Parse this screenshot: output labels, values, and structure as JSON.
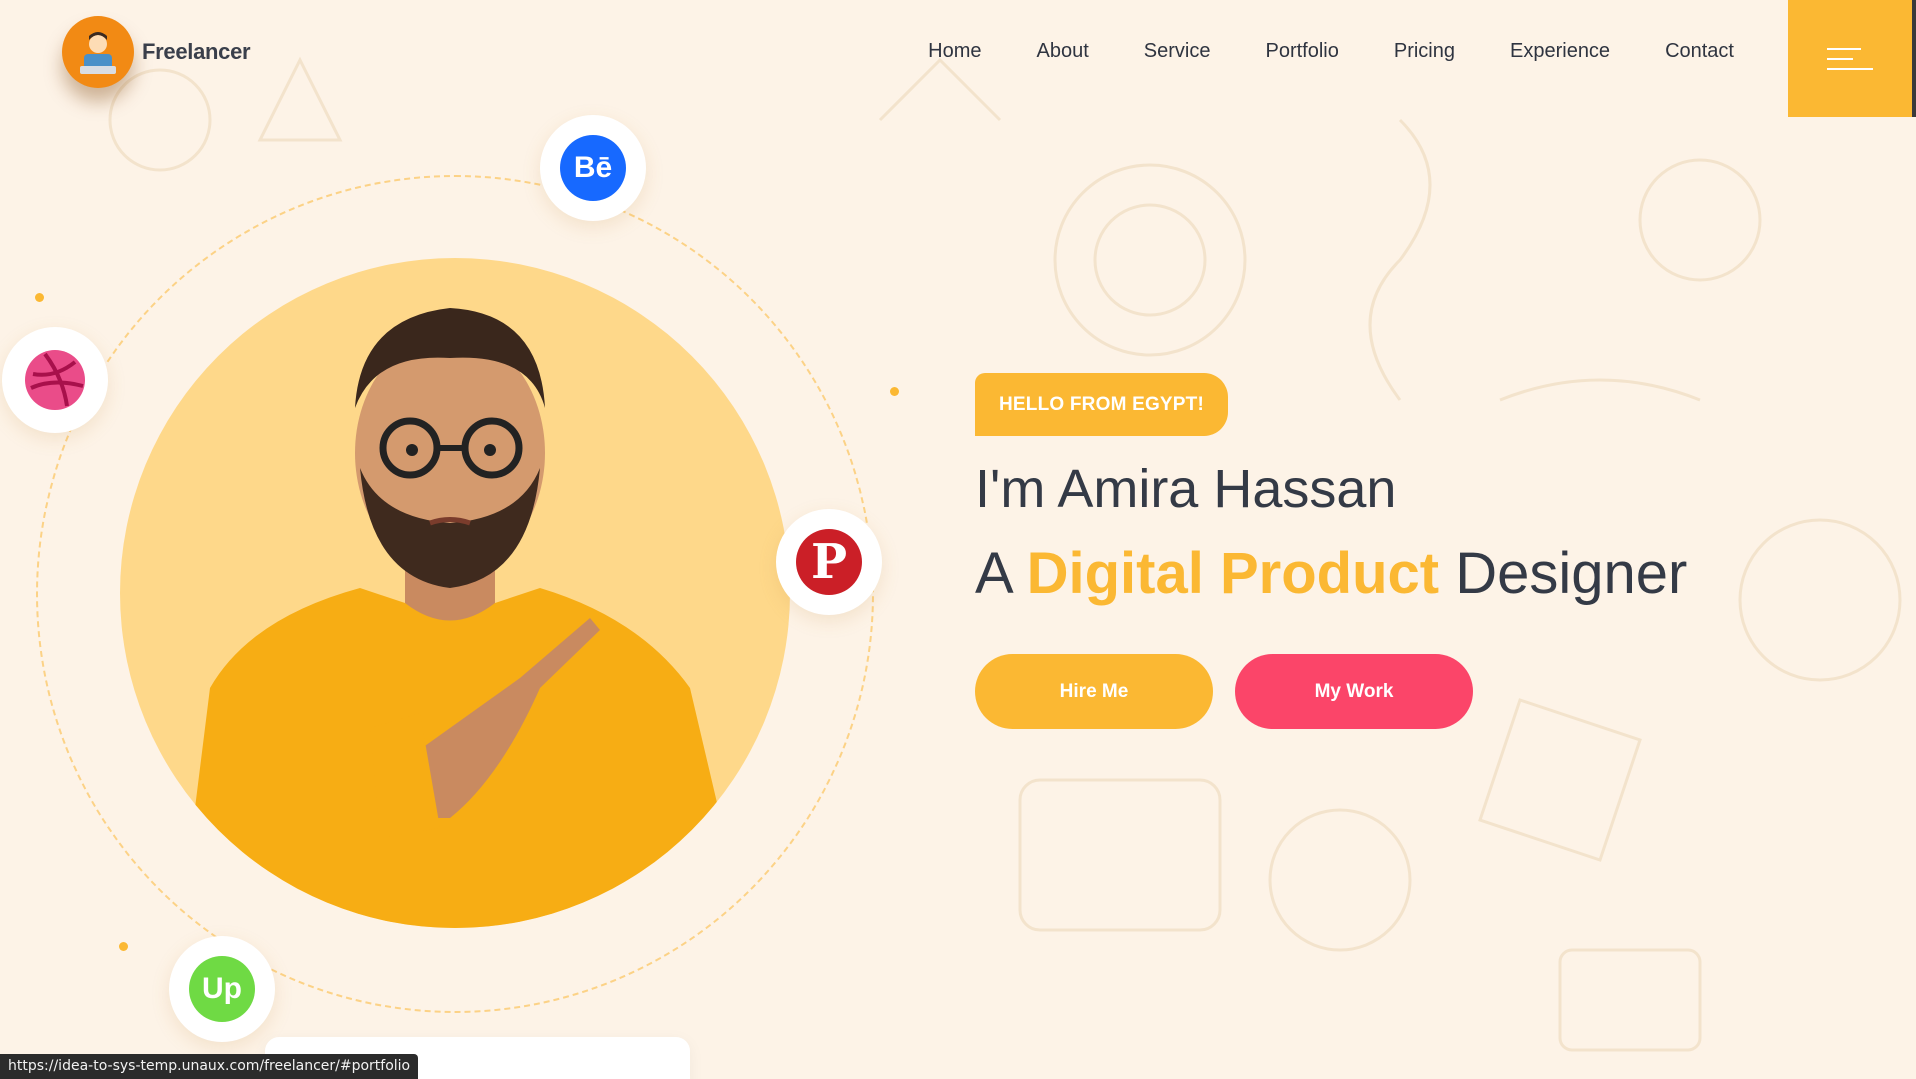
{
  "header": {
    "logo_text": "Freelancer",
    "nav": [
      "Home",
      "About",
      "Service",
      "Portfolio",
      "Pricing",
      "Experience",
      "Contact"
    ]
  },
  "hero": {
    "badge": "HELLO FROM EGYPT!",
    "intro": "I'm Amira Hassan",
    "role_prefix": "A",
    "role_highlight": "Digital Product",
    "role_suffix": "Designer",
    "hire_button": "Hire Me",
    "work_button": "My Work"
  },
  "social_icons": [
    "behance-icon",
    "dribbble-icon",
    "pinterest-icon",
    "upwork-icon"
  ],
  "status_bar": {
    "url": "https://idea-to-sys-temp.unaux.com/freelancer/#portfolio"
  },
  "colors": {
    "background": "#fdf3e7",
    "accent_yellow": "#fbb833",
    "accent_pink": "#fb4569",
    "text_dark": "#343a46"
  }
}
